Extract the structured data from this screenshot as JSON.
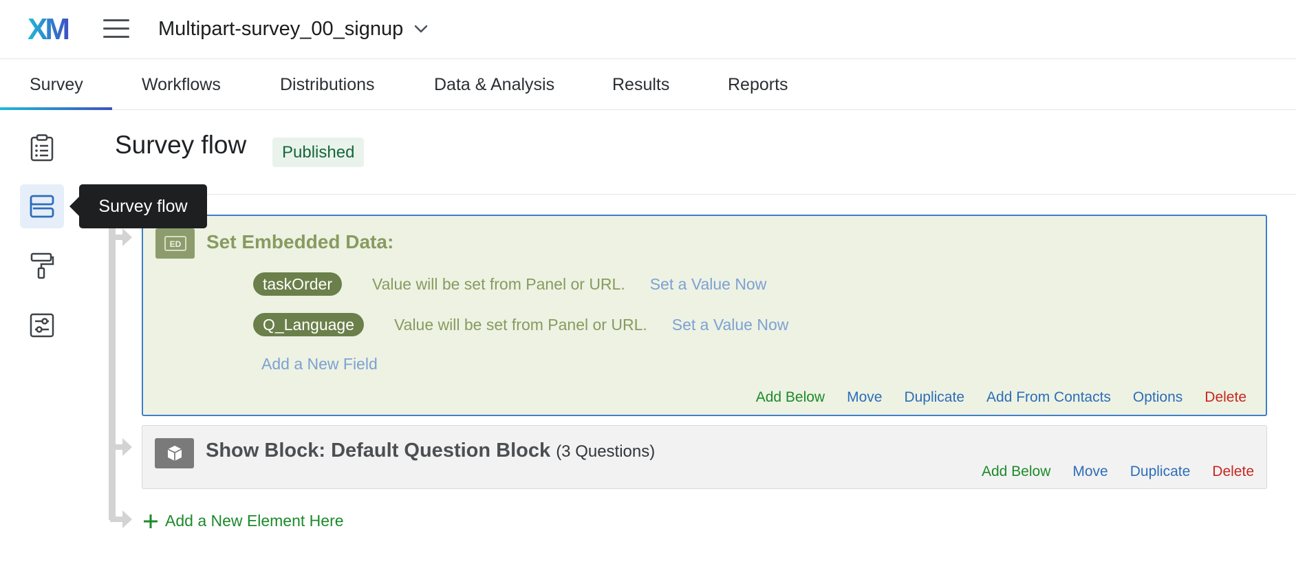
{
  "header": {
    "logo_text": "XM",
    "project_name": "Multipart-survey_00_signup"
  },
  "tabs": [
    {
      "label": "Survey",
      "active": true
    },
    {
      "label": "Workflows"
    },
    {
      "label": "Distributions"
    },
    {
      "label": "Data & Analysis"
    },
    {
      "label": "Results"
    },
    {
      "label": "Reports"
    }
  ],
  "rail": {
    "items": [
      {
        "icon": "clipboard-icon"
      },
      {
        "icon": "survey-flow-icon",
        "active": true
      },
      {
        "icon": "paint-roller-icon"
      },
      {
        "icon": "settings-sliders-icon"
      }
    ],
    "tooltip": "Survey flow"
  },
  "page": {
    "title": "Survey flow",
    "status_badge": "Published"
  },
  "embedded_block": {
    "icon_label": "ED",
    "title": "Set Embedded Data:",
    "fields": [
      {
        "name": "taskOrder",
        "desc": "Value will be set from Panel or URL.",
        "action": "Set a Value Now"
      },
      {
        "name": "Q_Language",
        "desc": "Value will be set from Panel or URL.",
        "action": "Set a Value Now"
      }
    ],
    "add_field": "Add a New Field",
    "actions": {
      "add_below": "Add Below",
      "move": "Move",
      "duplicate": "Duplicate",
      "add_from_contacts": "Add From Contacts",
      "options": "Options",
      "delete": "Delete"
    }
  },
  "show_block": {
    "title": "Show Block: Default Question Block",
    "count": "(3 Questions)",
    "actions": {
      "add_below": "Add Below",
      "move": "Move",
      "duplicate": "Duplicate",
      "delete": "Delete"
    }
  },
  "add_element": "Add a New Element Here",
  "colors": {
    "accent_gradient_start": "#21b9d6",
    "accent_gradient_end": "#3b52c4",
    "embedded_bg": "#edf2e3",
    "embedded_title": "#879b5f",
    "action_green": "#1c8a2b",
    "action_blue": "#2d6db8",
    "action_red": "#c9261f"
  }
}
